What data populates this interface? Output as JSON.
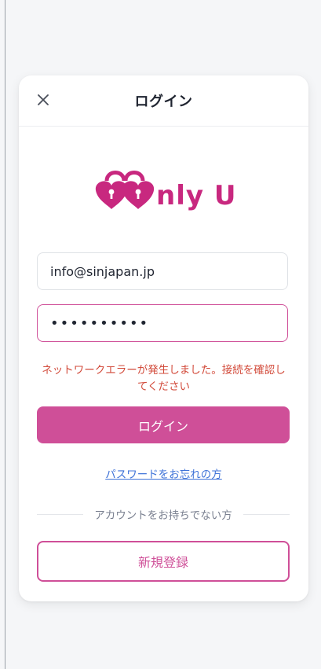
{
  "header": {
    "title": "ログイン",
    "close_icon": "close-icon"
  },
  "logo": {
    "text": "Only U",
    "brand_color": "#c8287f"
  },
  "form": {
    "email_value": "info@sinjapan.jp",
    "password_value": "••••••••••",
    "error_message": "ネットワークエラーが発生しました。接続を確認してください",
    "submit_label": "ログイン",
    "forgot_link": "パスワードをお忘れの方"
  },
  "signup": {
    "divider_text": "アカウントをお持ちでない方",
    "button_label": "新規登録"
  },
  "colors": {
    "accent": "#cf4f98",
    "error": "#d24a3a",
    "link": "#3f73d8"
  }
}
